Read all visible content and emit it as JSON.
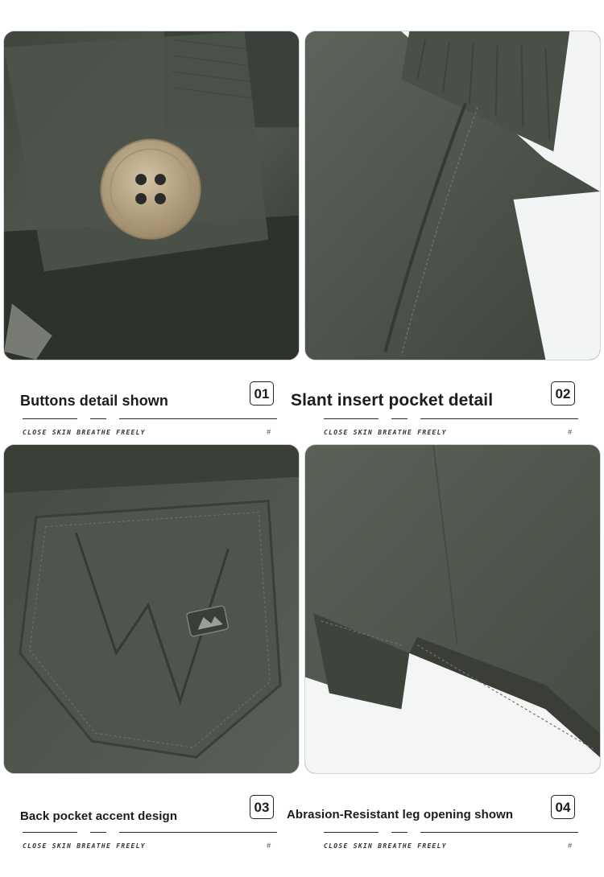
{
  "panels": [
    {
      "number": "01",
      "title": "Buttons detail shown",
      "slogan": "CLOSE SKIN BREATHE FREELY",
      "hash": "#",
      "image": "button-closeup-photo"
    },
    {
      "number": "02",
      "title": "Slant insert pocket detail",
      "slogan": "CLOSE SKIN BREATHE FREELY",
      "hash": "#",
      "image": "side-pocket-photo"
    },
    {
      "number": "03",
      "title": "Back pocket accent design",
      "slogan": "CLOSE SKIN BREATHE FREELY",
      "hash": "#",
      "image": "back-pocket-photo"
    },
    {
      "number": "04",
      "title": "Abrasion-Resistant leg opening shown",
      "slogan": "CLOSE SKIN BREATHE FREELY",
      "hash": "#",
      "image": "leg-opening-photo"
    }
  ],
  "colors": {
    "fabric": "#4a4f47",
    "fabric_dark": "#2f332e",
    "button": "#b9a787",
    "text": "#1c1c1c"
  }
}
